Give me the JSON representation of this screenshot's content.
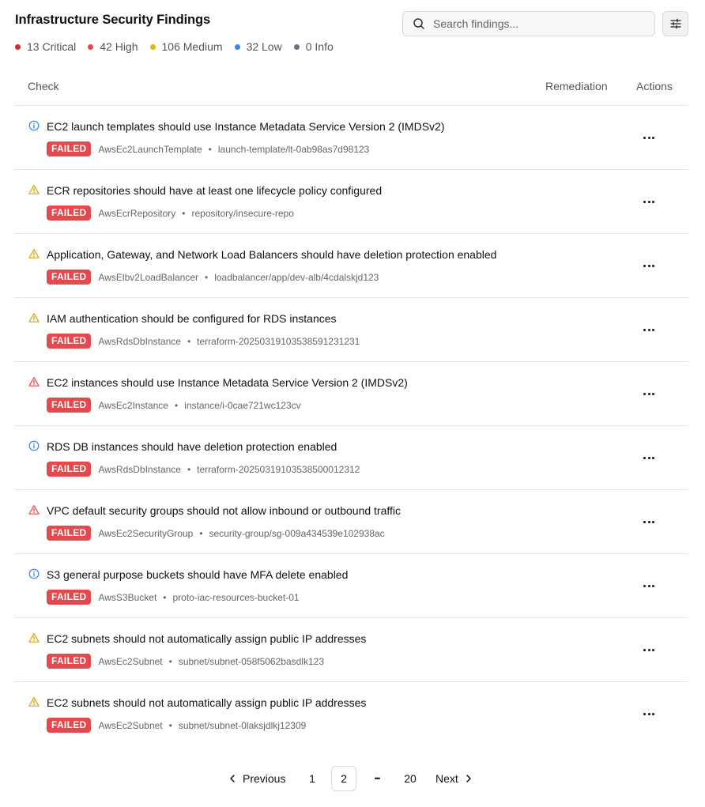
{
  "header": {
    "title": "Infrastructure Security Findings",
    "search_placeholder": "Search findings...",
    "stats": [
      {
        "label": "13 Critical",
        "color": "#dc2626"
      },
      {
        "label": "42 High",
        "color": "#ef4444"
      },
      {
        "label": "106 Medium",
        "color": "#eab308"
      },
      {
        "label": "32 Low",
        "color": "#3b82f6"
      },
      {
        "label": "0 Info",
        "color": "#6b7280"
      }
    ]
  },
  "table": {
    "columns": {
      "check": "Check",
      "remediation": "Remediation",
      "actions": "Actions"
    },
    "rows": [
      {
        "severity": "info",
        "title": "EC2 launch templates should use Instance Metadata Service Version 2 (IMDSv2)",
        "status": "FAILED",
        "resource_type": "AwsEc2LaunchTemplate",
        "resource_id": "launch-template/lt-0ab98as7d98123"
      },
      {
        "severity": "medium",
        "title": "ECR repositories should have at least one lifecycle policy configured",
        "status": "FAILED",
        "resource_type": "AwsEcrRepository",
        "resource_id": "repository/insecure-repo"
      },
      {
        "severity": "medium",
        "title": "Application, Gateway, and Network Load Balancers should have deletion protection enabled",
        "status": "FAILED",
        "resource_type": "AwsElbv2LoadBalancer",
        "resource_id": "loadbalancer/app/dev-alb/4cdalskjd123"
      },
      {
        "severity": "medium",
        "title": "IAM authentication should be configured for RDS instances",
        "status": "FAILED",
        "resource_type": "AwsRdsDbInstance",
        "resource_id": "terraform-20250319103538591231231"
      },
      {
        "severity": "high",
        "title": "EC2 instances should use Instance Metadata Service Version 2 (IMDSv2)",
        "status": "FAILED",
        "resource_type": "AwsEc2Instance",
        "resource_id": "instance/i-0cae721wc123cv"
      },
      {
        "severity": "info",
        "title": "RDS DB instances should have deletion protection enabled",
        "status": "FAILED",
        "resource_type": "AwsRdsDbInstance",
        "resource_id": "terraform-20250319103538500012312"
      },
      {
        "severity": "high",
        "title": "VPC default security groups should not allow inbound or outbound traffic",
        "status": "FAILED",
        "resource_type": "AwsEc2SecurityGroup",
        "resource_id": "security-group/sg-009a434539e102938ac"
      },
      {
        "severity": "info",
        "title": "S3 general purpose buckets should have MFA delete enabled",
        "status": "FAILED",
        "resource_type": "AwsS3Bucket",
        "resource_id": "proto-iac-resources-bucket-01"
      },
      {
        "severity": "medium",
        "title": "EC2 subnets should not automatically assign public IP addresses",
        "status": "FAILED",
        "resource_type": "AwsEc2Subnet",
        "resource_id": "subnet/subnet-058f5062basdlk123"
      },
      {
        "severity": "medium",
        "title": "EC2 subnets should not automatically assign public IP addresses",
        "status": "FAILED",
        "resource_type": "AwsEc2Subnet",
        "resource_id": "subnet/subnet-0laksjdlkj12309"
      }
    ]
  },
  "pagination": {
    "previous": "Previous",
    "next": "Next",
    "page_first": "1",
    "page_current": "2",
    "ellipsis": "•••",
    "page_last": "20"
  },
  "colors": {
    "failed_badge": "#e5484d",
    "info_icon": "#3b82f6",
    "medium_icon": "#d9a406",
    "high_icon": "#ef4444"
  }
}
